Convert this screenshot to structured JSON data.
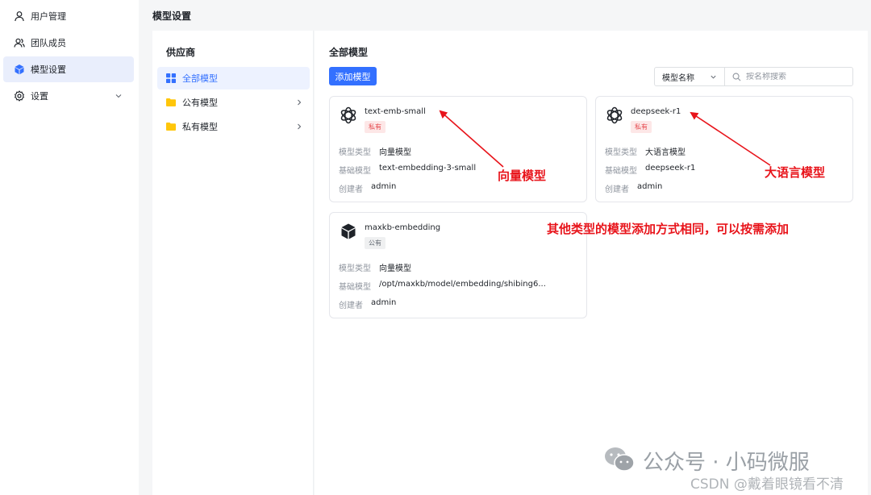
{
  "sidebar": {
    "items": [
      {
        "label": "用户管理",
        "icon": "user-icon",
        "active": false
      },
      {
        "label": "团队成员",
        "icon": "team-icon",
        "active": false
      },
      {
        "label": "模型设置",
        "icon": "cube-icon",
        "active": true
      },
      {
        "label": "设置",
        "icon": "gear-icon",
        "active": false,
        "expandable": true
      }
    ]
  },
  "header": {
    "title": "模型设置"
  },
  "providers": {
    "title": "供应商",
    "items": [
      {
        "label": "全部模型",
        "icon": "grid-icon",
        "active": true
      },
      {
        "label": "公有模型",
        "icon": "folder-icon",
        "expandable": true
      },
      {
        "label": "私有模型",
        "icon": "folder-icon",
        "expandable": true
      }
    ]
  },
  "models": {
    "title": "全部模型",
    "add_label": "添加模型",
    "search": {
      "select_value": "模型名称",
      "placeholder": "按名称搜索"
    },
    "field_labels": {
      "type": "模型类型",
      "base": "基础模型",
      "creator": "创建者"
    },
    "cards": [
      {
        "name": "text-emb-small",
        "tag": "私有",
        "tag_kind": "private",
        "logo": "openai-icon",
        "type": "向量模型",
        "base": "text-embedding-3-small",
        "creator": "admin"
      },
      {
        "name": "deepseek-r1",
        "tag": "私有",
        "tag_kind": "private",
        "logo": "openai-icon",
        "type": "大语言模型",
        "base": "deepseek-r1",
        "creator": "admin"
      },
      {
        "name": "maxkb-embedding",
        "tag": "公有",
        "tag_kind": "public",
        "logo": "cube-icon",
        "type": "向量模型",
        "base": "/opt/maxkb/model/embedding/shibing6...",
        "creator": "admin"
      }
    ]
  },
  "annotations": {
    "vector": "向量模型",
    "llm": "大语言模型",
    "note": "其他类型的模型添加方式相同，可以按需添加",
    "color": "#e8141b"
  },
  "watermark": {
    "line1": "公众号 · 小码微服",
    "line2": "CSDN @戴着眼镜看不清"
  },
  "colors": {
    "accent": "#3370ff",
    "active_bg": "#e9eefc"
  }
}
